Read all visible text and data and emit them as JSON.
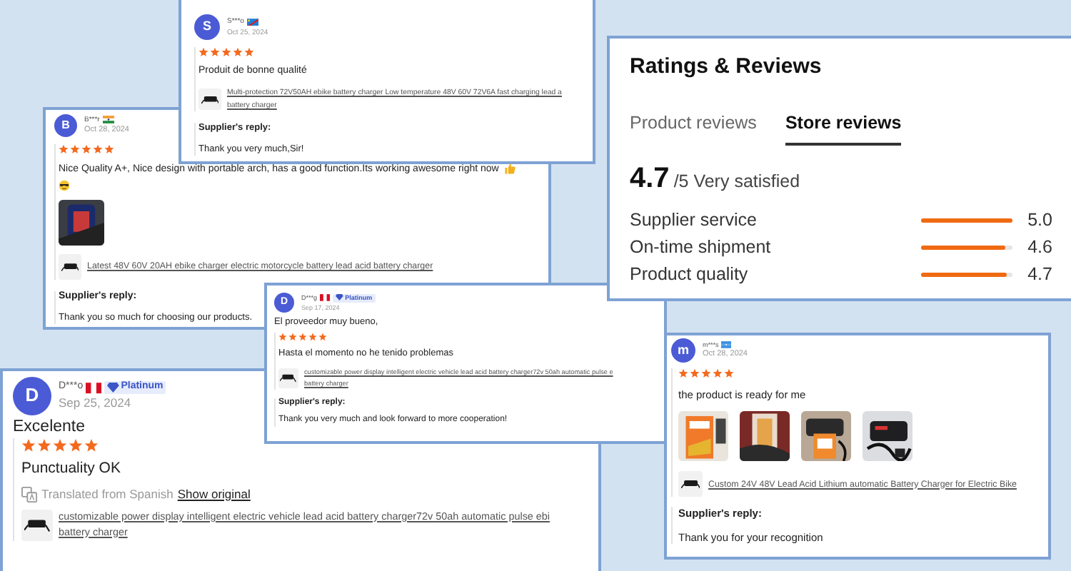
{
  "reviews": [
    {
      "avatar": "S",
      "name": "S***o",
      "date": "Oct 25, 2024",
      "stars": 5,
      "text": "Produit de bonne qualité",
      "product_link": [
        "Multi-protection 72V50AH ebike battery charger Low temperature 48V 60V 72V6A fast charging lead a",
        "battery charger"
      ],
      "reply_label": "Supplier's reply:",
      "reply": "Thank you very much,Sir!"
    },
    {
      "avatar": "B",
      "name": "B***r",
      "date": "Oct 28, 2024",
      "stars": 5,
      "text": "Nice Quality A+, Nice design with portable arch, has a good function.Its working awesome right now",
      "photos": [
        {
          "kind": "picture"
        }
      ],
      "product_link": [
        "Latest 48V 60V 20AH ebike charger electric motorcycle battery lead acid battery charger"
      ],
      "reply_label": "Supplier's reply:",
      "reply": "Thank you so much for choosing our products."
    },
    {
      "avatar": "D",
      "name": "D***g",
      "badge": "Platinum",
      "date": "Sep 17, 2024",
      "headline": "El proveedor muy bueno,",
      "stars": 5,
      "text": "Hasta el momento no he tenido problemas",
      "product_link": [
        "customizable power display intelligent electric vehicle lead acid battery charger72v 50ah automatic pulse e",
        "battery charger"
      ],
      "reply_label": "Supplier's reply:",
      "reply": "Thank you very much and look forward to more cooperation!"
    },
    {
      "avatar": "D",
      "name": "D***o",
      "badge": "Platinum",
      "date": "Sep 25, 2024",
      "headline": "Excelente",
      "stars": 5,
      "text": "Punctuality OK",
      "translation": {
        "note": "Translated from Spanish",
        "link": "Show original"
      },
      "product_link": [
        "customizable power display intelligent electric vehicle lead acid battery charger72v 50ah automatic pulse ebi",
        "battery charger"
      ]
    },
    {
      "avatar": "m",
      "name": "m***s",
      "date": "Oct 28, 2024",
      "stars": 5,
      "text": "the product is ready for me",
      "photos": [
        {
          "kind": "picture"
        },
        {
          "kind": "picture"
        },
        {
          "kind": "picture"
        },
        {
          "kind": "picture"
        }
      ],
      "product_link": [
        "Custom 24V 48V Lead Acid Lithium automatic Battery Charger for Electric Bike"
      ],
      "reply_label": "Supplier's reply:",
      "reply": "Thank you for your recognition"
    }
  ],
  "ratings": {
    "title": "Ratings & Reviews",
    "tabs": [
      {
        "label": "Product reviews",
        "selected": false
      },
      {
        "label": "Store reviews",
        "selected": true
      }
    ],
    "score": "4.7",
    "score_suffix": "/5 Very satisfied",
    "metrics": [
      {
        "label": "Supplier service",
        "level": 1.0,
        "value": "5.0"
      },
      {
        "label": "On-time shipment",
        "level": 0.92,
        "value": "4.6"
      },
      {
        "label": "Product quality",
        "level": 0.94,
        "value": "4.7"
      }
    ]
  }
}
